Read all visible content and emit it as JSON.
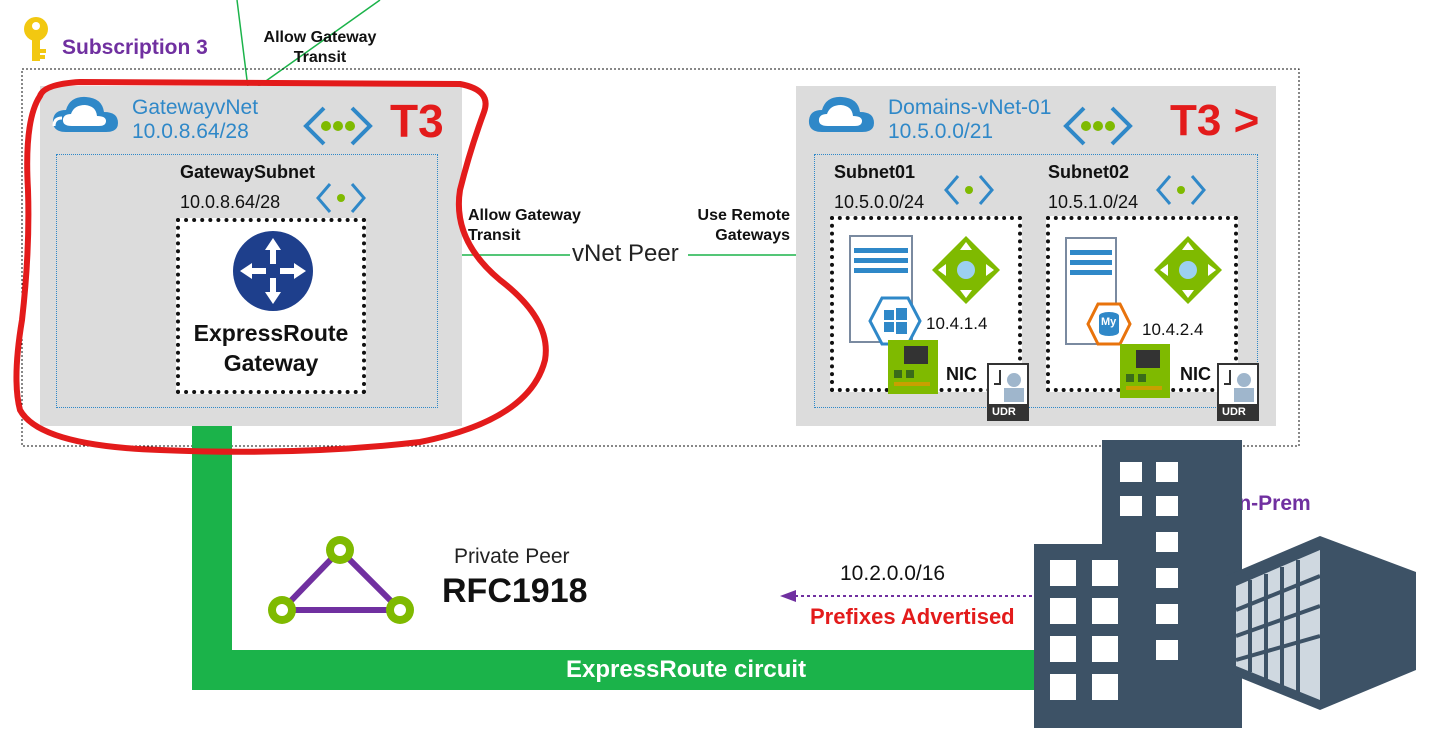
{
  "subscription": {
    "label": "Subscription 3"
  },
  "top_link": {
    "label_line1": "Allow Gateway",
    "label_line2": "Transit"
  },
  "gateway_vnet": {
    "name": "GatewayvNet",
    "cidr": "10.0.8.64/28",
    "tag": "T3",
    "subnet": {
      "name": "GatewaySubnet",
      "cidr": "10.0.8.64/28"
    },
    "gateway": {
      "line1": "ExpressRoute",
      "line2": "Gateway"
    }
  },
  "peering": {
    "left_line1": "Allow Gateway",
    "left_line2": "Transit",
    "center": "vNet Peer",
    "right_line1": "Use Remote",
    "right_line2": "Gateways"
  },
  "domains_vnet": {
    "name": "Domains-vNet-01",
    "cidr": "10.5.0.0/21",
    "tag": "T3 >",
    "subnets": [
      {
        "name": "Subnet01",
        "cidr": "10.5.0.0/24",
        "ip": "10.4.1.4",
        "nic": "NIC",
        "udr": "UDR"
      },
      {
        "name": "Subnet02",
        "cidr": "10.5.1.0/24",
        "ip": "10.4.2.4",
        "nic": "NIC",
        "udr": "UDR"
      }
    ],
    "mysql_badge": "My"
  },
  "private_peer": {
    "line1": "Private Peer",
    "line2": "RFC1918"
  },
  "onprem": {
    "label": "On-Prem",
    "prefix": "10.2.0.0/16",
    "advertised": "Prefixes Advertised"
  },
  "circuit": {
    "label": "ExpressRoute circuit"
  },
  "colors": {
    "azure_blue": "#2f88c8",
    "red": "#e31b1b",
    "green": "#1bb34a",
    "purple": "#7030a0",
    "building": "#3d5266"
  }
}
